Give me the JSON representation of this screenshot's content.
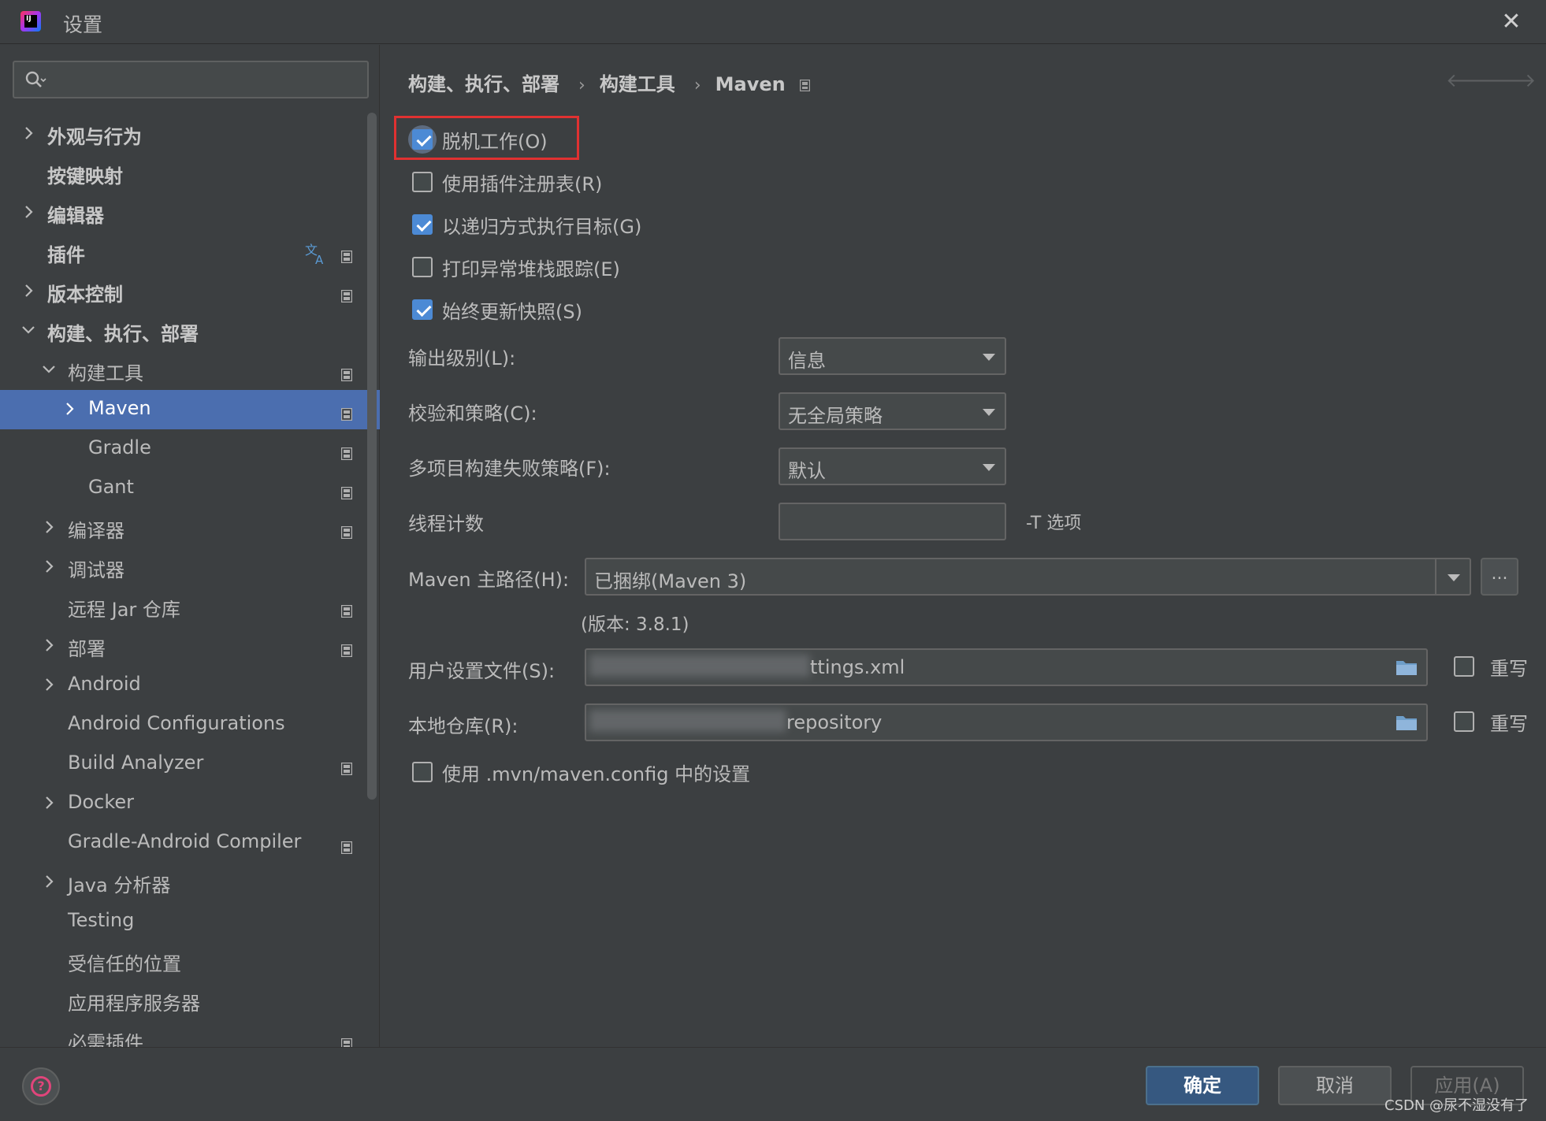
{
  "window": {
    "title": "设置",
    "close_glyph": "✕",
    "logo_text": "IJ"
  },
  "search": {
    "placeholder": ""
  },
  "sidebar": {
    "items": [
      {
        "label": "外观与行为",
        "level": 0,
        "expanded": false,
        "has_children": true,
        "bold": true
      },
      {
        "label": "按键映射",
        "level": 0,
        "has_children": false,
        "bold": true
      },
      {
        "label": "编辑器",
        "level": 0,
        "expanded": false,
        "has_children": true,
        "bold": true
      },
      {
        "label": "插件",
        "level": 0,
        "has_children": false,
        "bold": true,
        "translate_icon": true,
        "project_icon": true
      },
      {
        "label": "版本控制",
        "level": 0,
        "expanded": false,
        "has_children": true,
        "bold": true,
        "project_icon": true
      },
      {
        "label": "构建、执行、部署",
        "level": 0,
        "expanded": true,
        "has_children": true,
        "bold": true
      },
      {
        "label": "构建工具",
        "level": 1,
        "expanded": true,
        "has_children": true,
        "project_icon": true
      },
      {
        "label": "Maven",
        "level": 2,
        "expanded": false,
        "has_children": true,
        "selected": true,
        "project_icon": true
      },
      {
        "label": "Gradle",
        "level": 2,
        "has_children": false,
        "project_icon": true
      },
      {
        "label": "Gant",
        "level": 2,
        "has_children": false,
        "project_icon": true
      },
      {
        "label": "编译器",
        "level": 1,
        "expanded": false,
        "has_children": true,
        "project_icon": true
      },
      {
        "label": "调试器",
        "level": 1,
        "expanded": false,
        "has_children": true
      },
      {
        "label": "远程 Jar 仓库",
        "level": 1,
        "has_children": false,
        "project_icon": true
      },
      {
        "label": "部署",
        "level": 1,
        "expanded": false,
        "has_children": true,
        "project_icon": true
      },
      {
        "label": "Android",
        "level": 1,
        "expanded": false,
        "has_children": true
      },
      {
        "label": "Android Configurations",
        "level": 1,
        "has_children": false
      },
      {
        "label": "Build Analyzer",
        "level": 1,
        "has_children": false,
        "project_icon": true
      },
      {
        "label": "Docker",
        "level": 1,
        "expanded": false,
        "has_children": true
      },
      {
        "label": "Gradle-Android Compiler",
        "level": 1,
        "has_children": false,
        "project_icon": true
      },
      {
        "label": "Java 分析器",
        "level": 1,
        "expanded": false,
        "has_children": true
      },
      {
        "label": "Testing",
        "level": 1,
        "has_children": false
      },
      {
        "label": "受信任的位置",
        "level": 1,
        "has_children": false
      },
      {
        "label": "应用程序服务器",
        "level": 1,
        "has_children": false
      },
      {
        "label": "必需插件",
        "level": 1,
        "has_children": false,
        "project_icon": true
      }
    ]
  },
  "breadcrumb": {
    "items": [
      "构建、执行、部署",
      "构建工具",
      "Maven"
    ],
    "separator": "›"
  },
  "nav": {
    "back_glyph": "🡐",
    "forward_glyph": "🡒"
  },
  "options": {
    "offline": {
      "label": "脱机工作(O)",
      "checked": true
    },
    "plugin_registry": {
      "label": "使用插件注册表(R)",
      "checked": false
    },
    "recursive": {
      "label": "以递归方式执行目标(G)",
      "checked": true
    },
    "print_stack": {
      "label": "打印异常堆栈跟踪(E)",
      "checked": false
    },
    "always_update": {
      "label": "始终更新快照(S)",
      "checked": true
    },
    "use_mvn_config": {
      "label": "使用 .mvn/maven.config 中的设置",
      "checked": false
    }
  },
  "form": {
    "output_level": {
      "label": "输出级别(L):",
      "value": "信息"
    },
    "checksum_policy": {
      "label": "校验和策略(C):",
      "value": "无全局策略"
    },
    "multiproject_fail": {
      "label": "多项目构建失败策略(F):",
      "value": "默认"
    },
    "thread_count": {
      "label": "线程计数",
      "value": "",
      "suffix": "-T 选项"
    },
    "maven_home": {
      "label": "Maven 主路径(H):",
      "value": "已捆绑(Maven 3)",
      "browse_label": "...",
      "version_note": "(版本: 3.8.1)"
    },
    "user_settings": {
      "label": "用户设置文件(S):",
      "value_visible": "ttings.xml",
      "override_label": "重写",
      "override_checked": false
    },
    "local_repo": {
      "label": "本地仓库(R):",
      "value_visible": "repository",
      "override_label": "重写",
      "override_checked": false
    }
  },
  "footer": {
    "help_glyph": "?",
    "ok_label": "确定",
    "cancel_label": "取消",
    "apply_label": "应用(A)",
    "watermark": "CSDN @尿不湿没有了"
  },
  "colors": {
    "background": "#3c3f41",
    "selection": "#4b6eaf",
    "accent_checkbox": "#4c8ad5",
    "highlight_box": "#e03131",
    "ok_button": "#365880"
  }
}
